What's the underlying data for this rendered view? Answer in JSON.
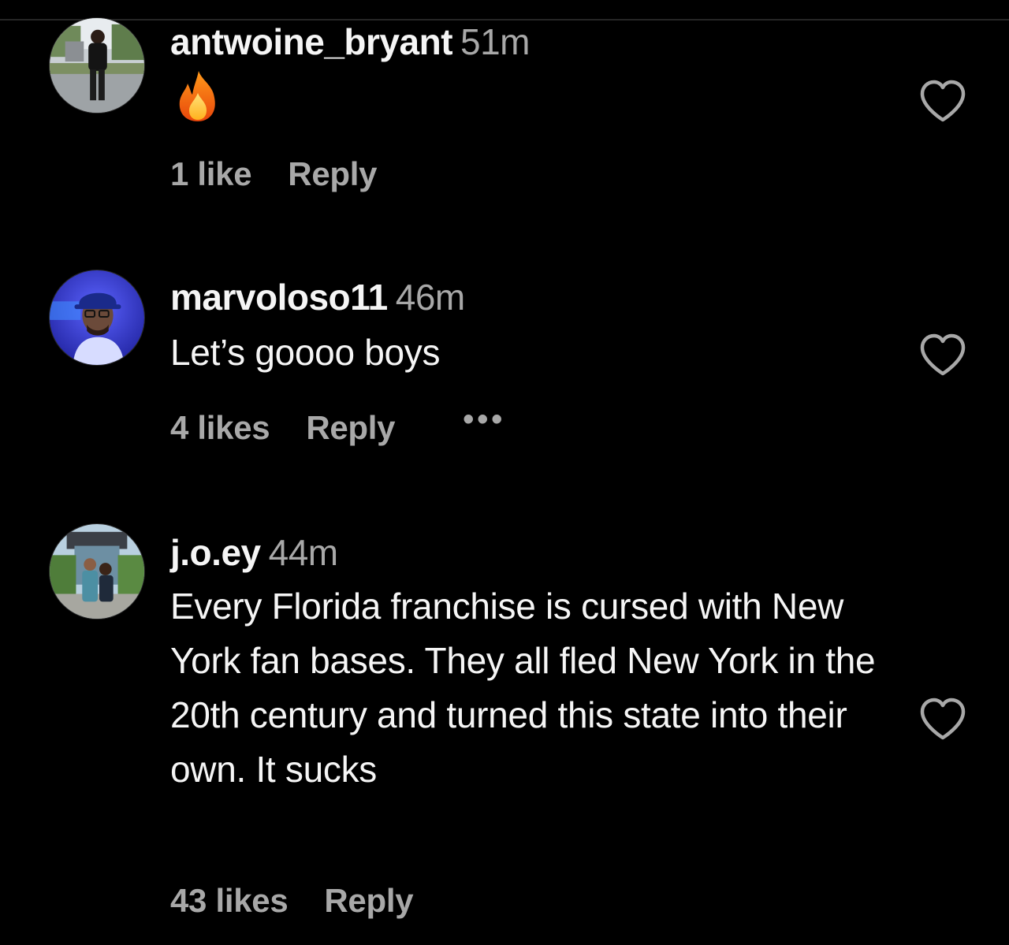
{
  "comments": [
    {
      "username": "antwoine_bryant",
      "time": "51m",
      "text": "🔥",
      "likes": "1 like",
      "reply_label": "Reply",
      "avatar_icon": "profile-photo",
      "text_icon": "fire-emoji-icon"
    },
    {
      "username": "marvoloso11",
      "time": "46m",
      "text": "Let’s goooo boys",
      "likes": "4 likes",
      "reply_label": "Reply",
      "more_label": "•••",
      "avatar_icon": "profile-photo"
    },
    {
      "username": "j.o.ey",
      "time": "44m",
      "text": "Every Florida franchise is cursed with New York fan bases. They all fled New York in the 20th century and turned this state into their own. It sucks",
      "likes": "43 likes",
      "reply_label": "Reply",
      "avatar_icon": "profile-photo"
    }
  ],
  "colors": {
    "background": "#000000",
    "primary_text": "#f5f5f5",
    "secondary_text": "#a8a8a8",
    "divider": "#262626"
  },
  "icons": {
    "like": "heart-outline-icon",
    "more": "more-options-icon"
  }
}
